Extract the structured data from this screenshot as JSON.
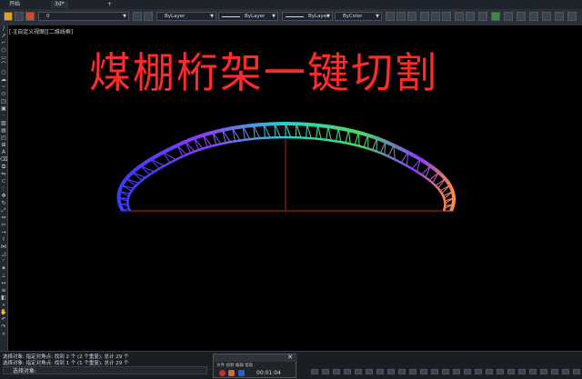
{
  "tabs": [
    {
      "label": "开始",
      "active": false
    },
    {
      "label": "3d*",
      "active": true
    },
    {
      "label": "+",
      "active": false
    }
  ],
  "toolbar": {
    "layer_dropdown": "0",
    "bylayer_1": "ByLayer",
    "bylayer_2": "ByLayer",
    "bylayer_3": "ByLayer",
    "bycolor": "ByColor"
  },
  "view_label": "[-][自定义视图][二维线框]",
  "title_text": "煤棚桁架一键切割",
  "command": {
    "line1": "选择对象: 指定对角点: 找到 2 个 (2 个重复), 总计 29 个",
    "line2": "选择对象: 指定对角点: 找到 1 个 (1 个重复), 总计 29 个",
    "prompt": "选择对象:"
  },
  "recorder": {
    "menu": "文件    视频    编辑    帮助",
    "time": "00:01:04"
  },
  "colors": {
    "title": "#ff2b2b",
    "truss_gradient": [
      "#3a3cff",
      "#8c3cff",
      "#2ad1c9",
      "#4cd964",
      "#ff8a3d"
    ]
  }
}
